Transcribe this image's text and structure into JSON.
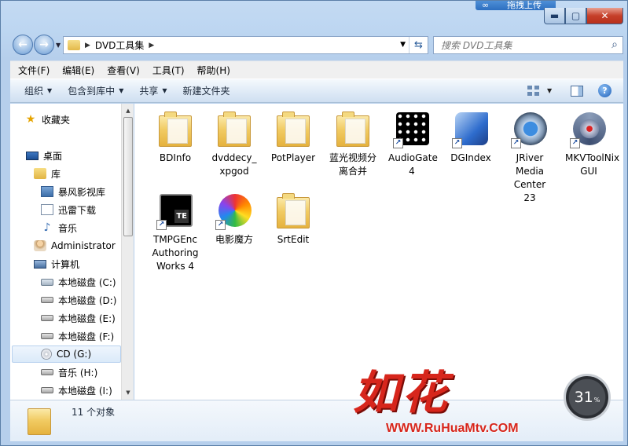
{
  "window": {
    "caption_tab": "拖拽上传",
    "min": "▬",
    "max": "▢",
    "close": "✕"
  },
  "address": {
    "path": "DVD工具集",
    "search_placeholder": "搜索 DVD工具集"
  },
  "menu": [
    "文件(F)",
    "编辑(E)",
    "查看(V)",
    "工具(T)",
    "帮助(H)"
  ],
  "toolbar": {
    "organize": "组织",
    "include_in_library": "包含到库中",
    "share": "共享",
    "new_folder": "新建文件夹"
  },
  "nav": {
    "favorites": "收藏夹",
    "desktop": "桌面",
    "library": "库",
    "lib_items": [
      "暴风影视库",
      "迅雷下载",
      "音乐"
    ],
    "user": "Administrator",
    "computer": "计算机",
    "drives": [
      "本地磁盘 (C:)",
      "本地磁盘 (D:)",
      "本地磁盘 (E:)",
      "本地磁盘 (F:)",
      "CD (G:)",
      "音乐 (H:)",
      "本地磁盘 (I:)"
    ]
  },
  "files": [
    {
      "name": "BDInfo",
      "type": "folder"
    },
    {
      "name": "dvddecy_xpgod",
      "type": "folder"
    },
    {
      "name": "PotPlayer",
      "type": "folder"
    },
    {
      "name": "蓝光视频分离合并",
      "type": "folder"
    },
    {
      "name": "AudioGate 4",
      "type": "shortcut"
    },
    {
      "name": "DGIndex",
      "type": "shortcut"
    },
    {
      "name": "JRiver Media Center 23",
      "type": "shortcut"
    },
    {
      "name": "MKVToolNix GUI",
      "type": "shortcut"
    },
    {
      "name": "TMPGEnc Authoring Works 4",
      "type": "shortcut"
    },
    {
      "name": "电影魔方",
      "type": "shortcut"
    },
    {
      "name": "SrtEdit",
      "type": "folder"
    }
  ],
  "details": {
    "count": "11 个对象"
  },
  "watermark": {
    "logo": "如花",
    "url": "WWW.RuHuaMtv.COM",
    "meter_value": "31",
    "meter_unit": "%"
  },
  "colors": {
    "accent": "#3a7ec9",
    "watermark_red": "#d7261c"
  }
}
